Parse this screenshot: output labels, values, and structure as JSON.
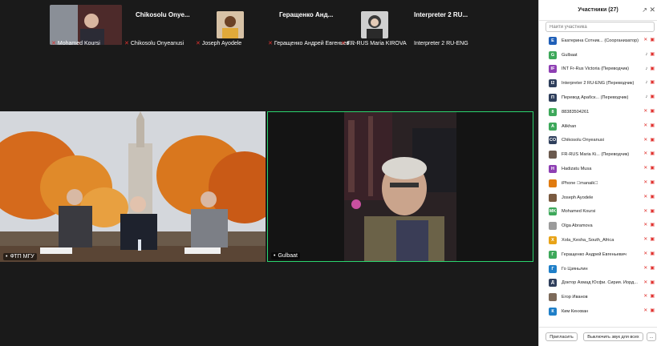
{
  "strip": {
    "tiles": [
      {
        "name": "Mohamed Koursi",
        "big": ""
      },
      {
        "name": "Chikosolu Onyeanusi",
        "big": "Chikosolu  Onye..."
      },
      {
        "name": "Joseph Ayodele",
        "big": ""
      },
      {
        "name": "Геращенко Андрей Евгеньев...",
        "big": "Геращенко  Анд..."
      },
      {
        "name": "FR-RUS Maria KIROVA",
        "big": ""
      },
      {
        "name": "Interpreter 2 RU-ENG",
        "big": "Interpreter  2  RU..."
      }
    ]
  },
  "videos": {
    "left_label": "ФТП МГУ",
    "right_label": "Gulbaat"
  },
  "panel": {
    "title": "Участники (27)",
    "search_placeholder": "Найти участника",
    "participants": [
      {
        "initial": "E",
        "color": "#1f5fb8",
        "name": "Екатерина Сотник... (Соорганизатор)",
        "mic": "off",
        "cam": "off"
      },
      {
        "initial": "G",
        "color": "#3da85a",
        "name": "Gulbaat",
        "mic": "on",
        "cam": "off"
      },
      {
        "initial": "IF",
        "color": "#8e3fb3",
        "name": "INT Fr-Rus Victoria (Переводчик)",
        "mic": "on",
        "cam": "off"
      },
      {
        "initial": "I2",
        "color": "#2f3f5c",
        "name": "Interpreter 2 RU-ENG (Переводчик)",
        "mic": "on",
        "cam": "off"
      },
      {
        "initial": "П",
        "color": "#2f3f5c",
        "name": "Перевод Арабск... (Переводчик)",
        "mic": "on",
        "cam": "off"
      },
      {
        "initial": "8",
        "color": "#3da85a",
        "name": "88383504261",
        "mic": "off",
        "cam": "off"
      },
      {
        "initial": "A",
        "color": "#3da85a",
        "name": "Alikhan",
        "mic": "off",
        "cam": "off"
      },
      {
        "initial": "CO",
        "color": "#2f3f5c",
        "name": "Chikosolu Onyeanusi",
        "mic": "off",
        "cam": "off"
      },
      {
        "initial": "",
        "color": "#6b5a4e",
        "name": "FR-RUS Maria Ki... (Переводчик)",
        "mic": "off",
        "cam": "off"
      },
      {
        "initial": "H",
        "color": "#8e3fb3",
        "name": "Hadizatu Musa",
        "mic": "off",
        "cam": "off"
      },
      {
        "initial": "",
        "color": "#e07b10",
        "name": "iPhone \u0000manaik\u0000",
        "mic": "off",
        "cam": "off"
      },
      {
        "initial": "",
        "color": "#7a5a40",
        "name": "Joseph Ayodele",
        "mic": "off",
        "cam": "off"
      },
      {
        "initial": "MK",
        "color": "#3da85a",
        "name": "Mohamed Koursi",
        "mic": "off",
        "cam": "off"
      },
      {
        "initial": "",
        "color": "#9b9b9b",
        "name": "Olga Abramova",
        "mic": "off",
        "cam": "off"
      },
      {
        "initial": "X",
        "color": "#e8a317",
        "name": "Xola_Kesha_South_Africa",
        "mic": "off",
        "cam": "off"
      },
      {
        "initial": "Г",
        "color": "#3da85a",
        "name": "Геращенко Андрей Евгеньевич",
        "mic": "off",
        "cam": "off"
      },
      {
        "initial": "Г",
        "color": "#1f7fc8",
        "name": "Го Цзяньлин",
        "mic": "off",
        "cam": "off"
      },
      {
        "initial": "Д",
        "color": "#2f3f5c",
        "name": "Доктор Ахмад Юсфи. Сирия. Иорд...",
        "mic": "off",
        "cam": "off"
      },
      {
        "initial": "",
        "color": "#7d6a5a",
        "name": "Егор Иванов",
        "mic": "off",
        "cam": "off"
      },
      {
        "initial": "К",
        "color": "#1f7fc8",
        "name": "Ким Кенхван",
        "mic": "off",
        "cam": "off"
      }
    ],
    "invite_label": "Пригласить",
    "mute_all_label": "Выключить звук для всех",
    "more_label": "..."
  }
}
